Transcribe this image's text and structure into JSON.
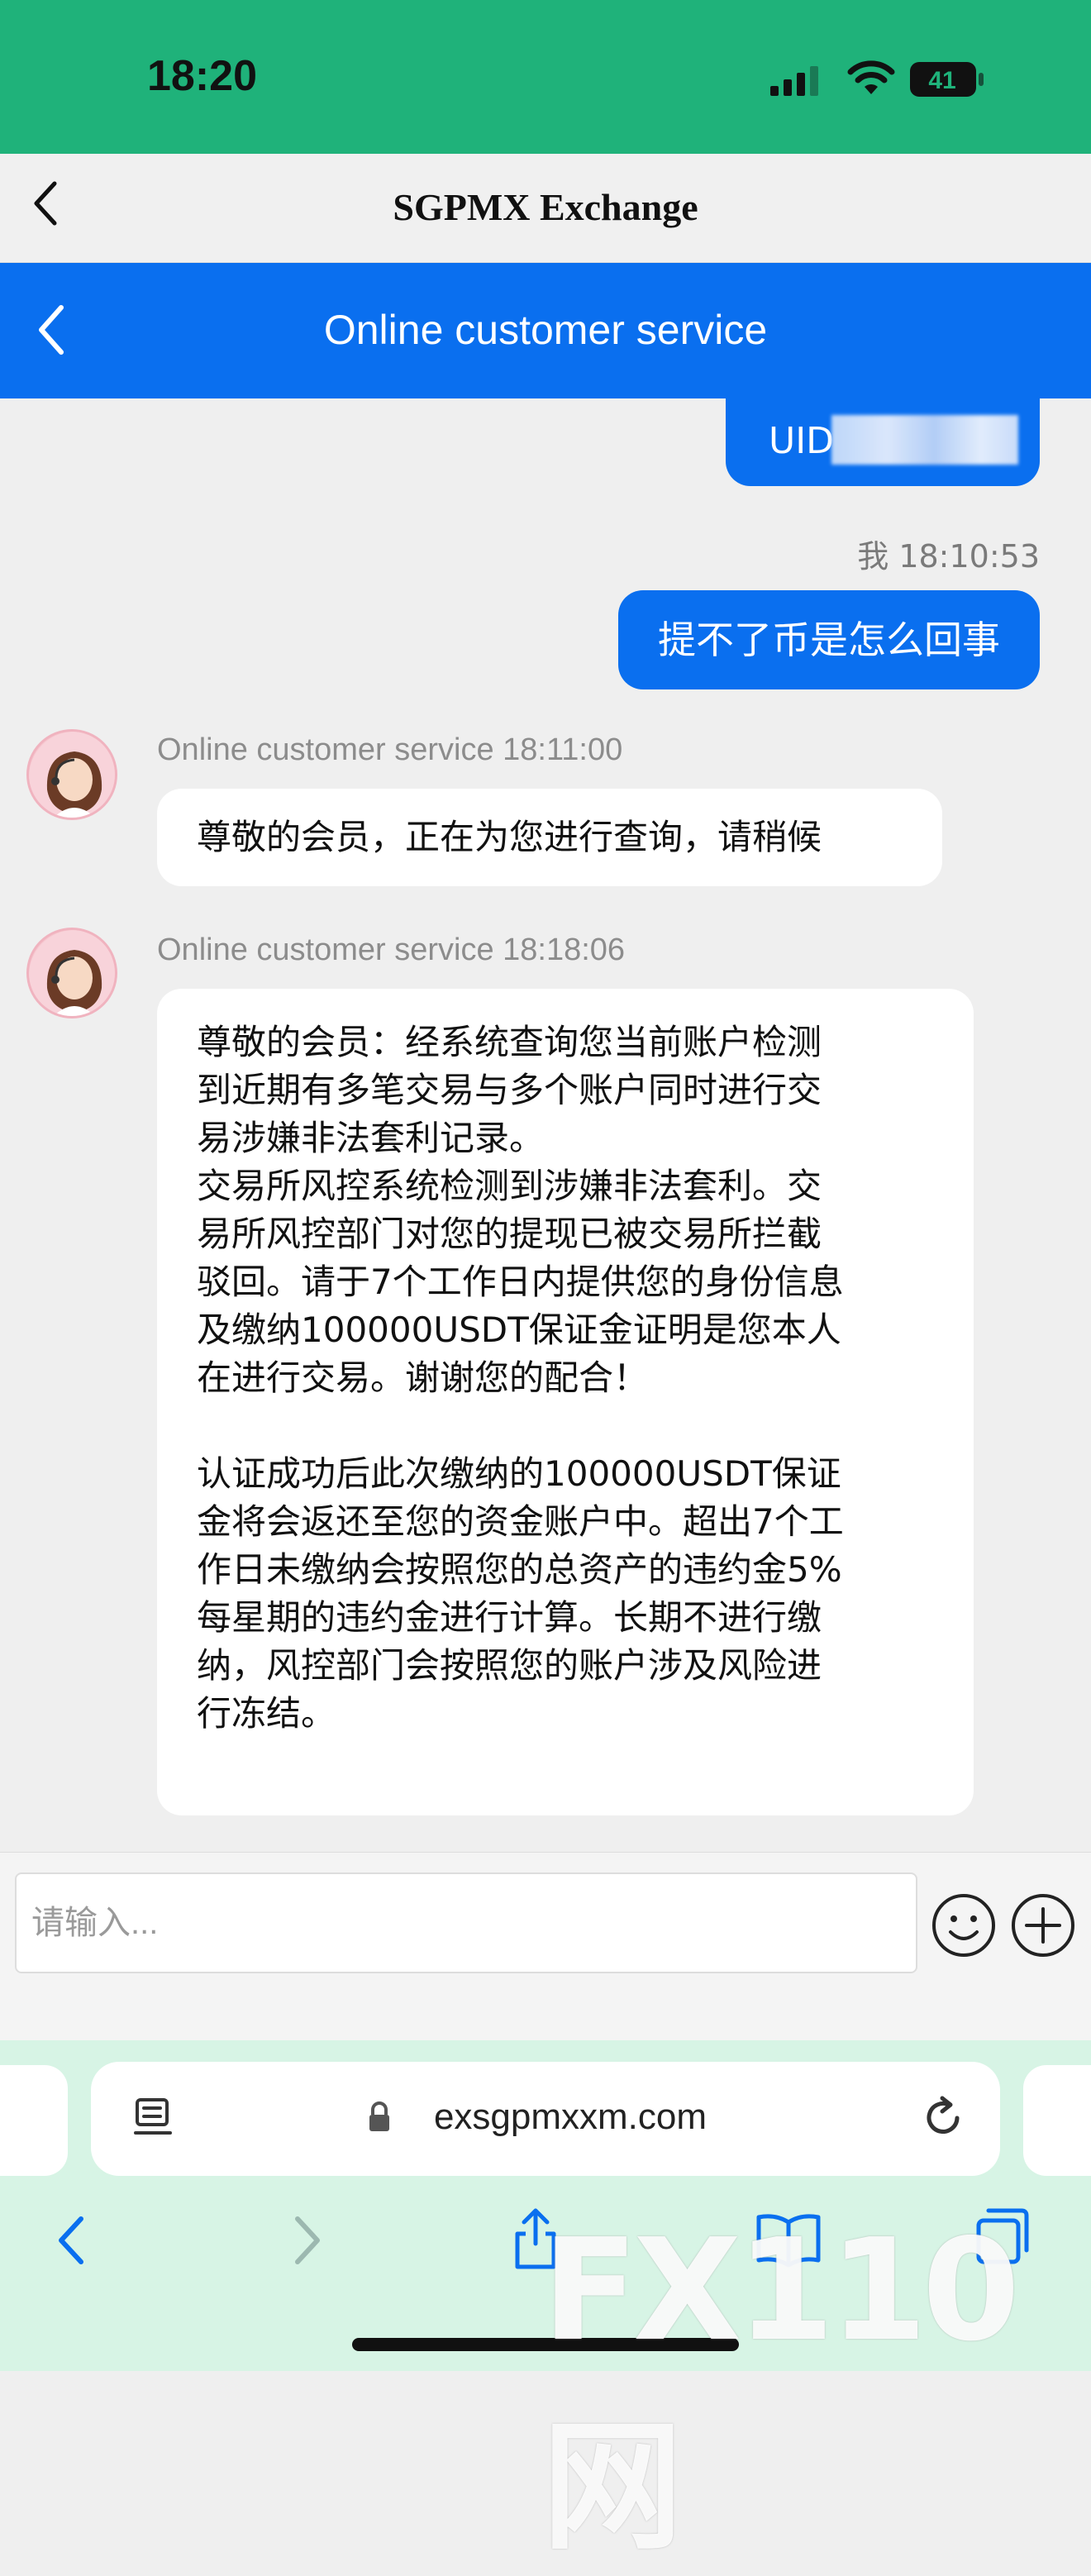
{
  "status_bar": {
    "time": "18:20",
    "battery": "41"
  },
  "app_header": {
    "title": "SGPMX Exchange"
  },
  "cs_header": {
    "title": "Online customer service"
  },
  "chat": {
    "uid_label": "UID",
    "outgoing_timestamp": "我 18:10:53",
    "question": "提不了币是怎么回事",
    "messages": [
      {
        "meta": "Online customer service 18:11:00",
        "text": "尊敬的会员，正在为您进行查询，请稍候"
      },
      {
        "meta": "Online customer service 18:18:06",
        "text": "尊敬的会员：经系统查询您当前账户检测\n到近期有多笔交易与多个账户同时进行交\n易涉嫌非法套利记录。\n交易所风控系统检测到涉嫌非法套利。交\n易所风控部门对您的提现已被交易所拦截\n驳回。请于7个工作日内提供您的身份信息\n及缴纳100000USDT保证金证明是您本人\n在进行交易。谢谢您的配合！\n\n认证成功后此次缴纳的100000USDT保证\n金将会返还至您的资金账户中。超出7个工\n作日未缴纳会按照您的总资产的违约金5%\n每星期的违约金进行计算。长期不进行缴\n纳，风控部门会按照您的账户涉及风险进\n行冻结。"
      }
    ]
  },
  "input": {
    "placeholder": "请输入..."
  },
  "browser": {
    "url": "exsgpmxxm.com"
  },
  "watermark": "FX110网",
  "colors": {
    "status_green": "#1fb27a",
    "primary_blue": "#0a6fef",
    "browser_mint": "#d7f4e5"
  }
}
